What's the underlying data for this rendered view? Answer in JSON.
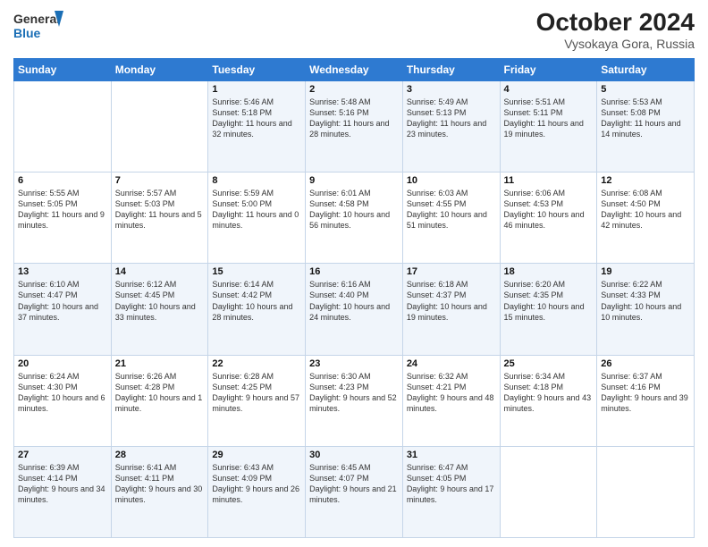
{
  "header": {
    "logo_line1": "General",
    "logo_line2": "Blue",
    "title": "October 2024",
    "subtitle": "Vysokaya Gora, Russia"
  },
  "weekdays": [
    "Sunday",
    "Monday",
    "Tuesday",
    "Wednesday",
    "Thursday",
    "Friday",
    "Saturday"
  ],
  "weeks": [
    [
      {
        "day": "",
        "sunrise": "",
        "sunset": "",
        "daylight": ""
      },
      {
        "day": "",
        "sunrise": "",
        "sunset": "",
        "daylight": ""
      },
      {
        "day": "1",
        "sunrise": "Sunrise: 5:46 AM",
        "sunset": "Sunset: 5:18 PM",
        "daylight": "Daylight: 11 hours and 32 minutes."
      },
      {
        "day": "2",
        "sunrise": "Sunrise: 5:48 AM",
        "sunset": "Sunset: 5:16 PM",
        "daylight": "Daylight: 11 hours and 28 minutes."
      },
      {
        "day": "3",
        "sunrise": "Sunrise: 5:49 AM",
        "sunset": "Sunset: 5:13 PM",
        "daylight": "Daylight: 11 hours and 23 minutes."
      },
      {
        "day": "4",
        "sunrise": "Sunrise: 5:51 AM",
        "sunset": "Sunset: 5:11 PM",
        "daylight": "Daylight: 11 hours and 19 minutes."
      },
      {
        "day": "5",
        "sunrise": "Sunrise: 5:53 AM",
        "sunset": "Sunset: 5:08 PM",
        "daylight": "Daylight: 11 hours and 14 minutes."
      }
    ],
    [
      {
        "day": "6",
        "sunrise": "Sunrise: 5:55 AM",
        "sunset": "Sunset: 5:05 PM",
        "daylight": "Daylight: 11 hours and 9 minutes."
      },
      {
        "day": "7",
        "sunrise": "Sunrise: 5:57 AM",
        "sunset": "Sunset: 5:03 PM",
        "daylight": "Daylight: 11 hours and 5 minutes."
      },
      {
        "day": "8",
        "sunrise": "Sunrise: 5:59 AM",
        "sunset": "Sunset: 5:00 PM",
        "daylight": "Daylight: 11 hours and 0 minutes."
      },
      {
        "day": "9",
        "sunrise": "Sunrise: 6:01 AM",
        "sunset": "Sunset: 4:58 PM",
        "daylight": "Daylight: 10 hours and 56 minutes."
      },
      {
        "day": "10",
        "sunrise": "Sunrise: 6:03 AM",
        "sunset": "Sunset: 4:55 PM",
        "daylight": "Daylight: 10 hours and 51 minutes."
      },
      {
        "day": "11",
        "sunrise": "Sunrise: 6:06 AM",
        "sunset": "Sunset: 4:53 PM",
        "daylight": "Daylight: 10 hours and 46 minutes."
      },
      {
        "day": "12",
        "sunrise": "Sunrise: 6:08 AM",
        "sunset": "Sunset: 4:50 PM",
        "daylight": "Daylight: 10 hours and 42 minutes."
      }
    ],
    [
      {
        "day": "13",
        "sunrise": "Sunrise: 6:10 AM",
        "sunset": "Sunset: 4:47 PM",
        "daylight": "Daylight: 10 hours and 37 minutes."
      },
      {
        "day": "14",
        "sunrise": "Sunrise: 6:12 AM",
        "sunset": "Sunset: 4:45 PM",
        "daylight": "Daylight: 10 hours and 33 minutes."
      },
      {
        "day": "15",
        "sunrise": "Sunrise: 6:14 AM",
        "sunset": "Sunset: 4:42 PM",
        "daylight": "Daylight: 10 hours and 28 minutes."
      },
      {
        "day": "16",
        "sunrise": "Sunrise: 6:16 AM",
        "sunset": "Sunset: 4:40 PM",
        "daylight": "Daylight: 10 hours and 24 minutes."
      },
      {
        "day": "17",
        "sunrise": "Sunrise: 6:18 AM",
        "sunset": "Sunset: 4:37 PM",
        "daylight": "Daylight: 10 hours and 19 minutes."
      },
      {
        "day": "18",
        "sunrise": "Sunrise: 6:20 AM",
        "sunset": "Sunset: 4:35 PM",
        "daylight": "Daylight: 10 hours and 15 minutes."
      },
      {
        "day": "19",
        "sunrise": "Sunrise: 6:22 AM",
        "sunset": "Sunset: 4:33 PM",
        "daylight": "Daylight: 10 hours and 10 minutes."
      }
    ],
    [
      {
        "day": "20",
        "sunrise": "Sunrise: 6:24 AM",
        "sunset": "Sunset: 4:30 PM",
        "daylight": "Daylight: 10 hours and 6 minutes."
      },
      {
        "day": "21",
        "sunrise": "Sunrise: 6:26 AM",
        "sunset": "Sunset: 4:28 PM",
        "daylight": "Daylight: 10 hours and 1 minute."
      },
      {
        "day": "22",
        "sunrise": "Sunrise: 6:28 AM",
        "sunset": "Sunset: 4:25 PM",
        "daylight": "Daylight: 9 hours and 57 minutes."
      },
      {
        "day": "23",
        "sunrise": "Sunrise: 6:30 AM",
        "sunset": "Sunset: 4:23 PM",
        "daylight": "Daylight: 9 hours and 52 minutes."
      },
      {
        "day": "24",
        "sunrise": "Sunrise: 6:32 AM",
        "sunset": "Sunset: 4:21 PM",
        "daylight": "Daylight: 9 hours and 48 minutes."
      },
      {
        "day": "25",
        "sunrise": "Sunrise: 6:34 AM",
        "sunset": "Sunset: 4:18 PM",
        "daylight": "Daylight: 9 hours and 43 minutes."
      },
      {
        "day": "26",
        "sunrise": "Sunrise: 6:37 AM",
        "sunset": "Sunset: 4:16 PM",
        "daylight": "Daylight: 9 hours and 39 minutes."
      }
    ],
    [
      {
        "day": "27",
        "sunrise": "Sunrise: 6:39 AM",
        "sunset": "Sunset: 4:14 PM",
        "daylight": "Daylight: 9 hours and 34 minutes."
      },
      {
        "day": "28",
        "sunrise": "Sunrise: 6:41 AM",
        "sunset": "Sunset: 4:11 PM",
        "daylight": "Daylight: 9 hours and 30 minutes."
      },
      {
        "day": "29",
        "sunrise": "Sunrise: 6:43 AM",
        "sunset": "Sunset: 4:09 PM",
        "daylight": "Daylight: 9 hours and 26 minutes."
      },
      {
        "day": "30",
        "sunrise": "Sunrise: 6:45 AM",
        "sunset": "Sunset: 4:07 PM",
        "daylight": "Daylight: 9 hours and 21 minutes."
      },
      {
        "day": "31",
        "sunrise": "Sunrise: 6:47 AM",
        "sunset": "Sunset: 4:05 PM",
        "daylight": "Daylight: 9 hours and 17 minutes."
      },
      {
        "day": "",
        "sunrise": "",
        "sunset": "",
        "daylight": ""
      },
      {
        "day": "",
        "sunrise": "",
        "sunset": "",
        "daylight": ""
      }
    ]
  ]
}
